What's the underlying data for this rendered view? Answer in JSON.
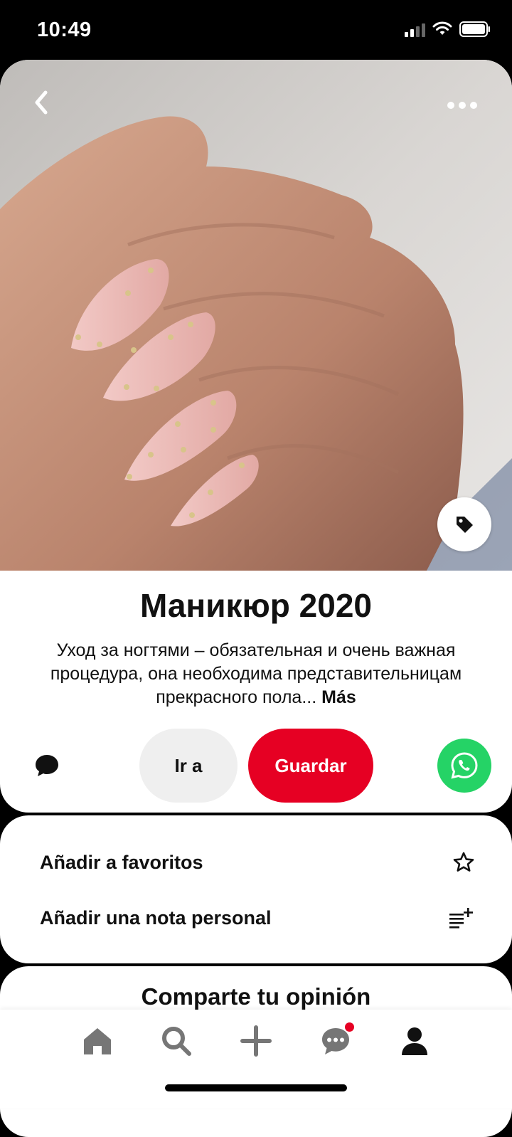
{
  "status_bar": {
    "time": "10:49"
  },
  "pin": {
    "title": "Маникюр 2020",
    "description": "Уход за ногтями – обязательная и очень важная процедура, она необходима представительницам прекрасного пола...",
    "more_link": "Más",
    "image_icon": "hand-with-almond-nails-image"
  },
  "actions": {
    "visit_label": "Ir a",
    "save_label": "Guardar",
    "save_color": "#e60023"
  },
  "options": [
    {
      "label": "Añadir a favoritos",
      "icon": "star-icon"
    },
    {
      "label": "Añadir una nota personal",
      "icon": "add-note-icon"
    }
  ],
  "comments": {
    "title": "Comparte tu opinión"
  },
  "nav": {
    "items": [
      "home-icon",
      "search-icon",
      "plus-icon",
      "messages-icon",
      "profile-icon"
    ],
    "active": "home"
  }
}
